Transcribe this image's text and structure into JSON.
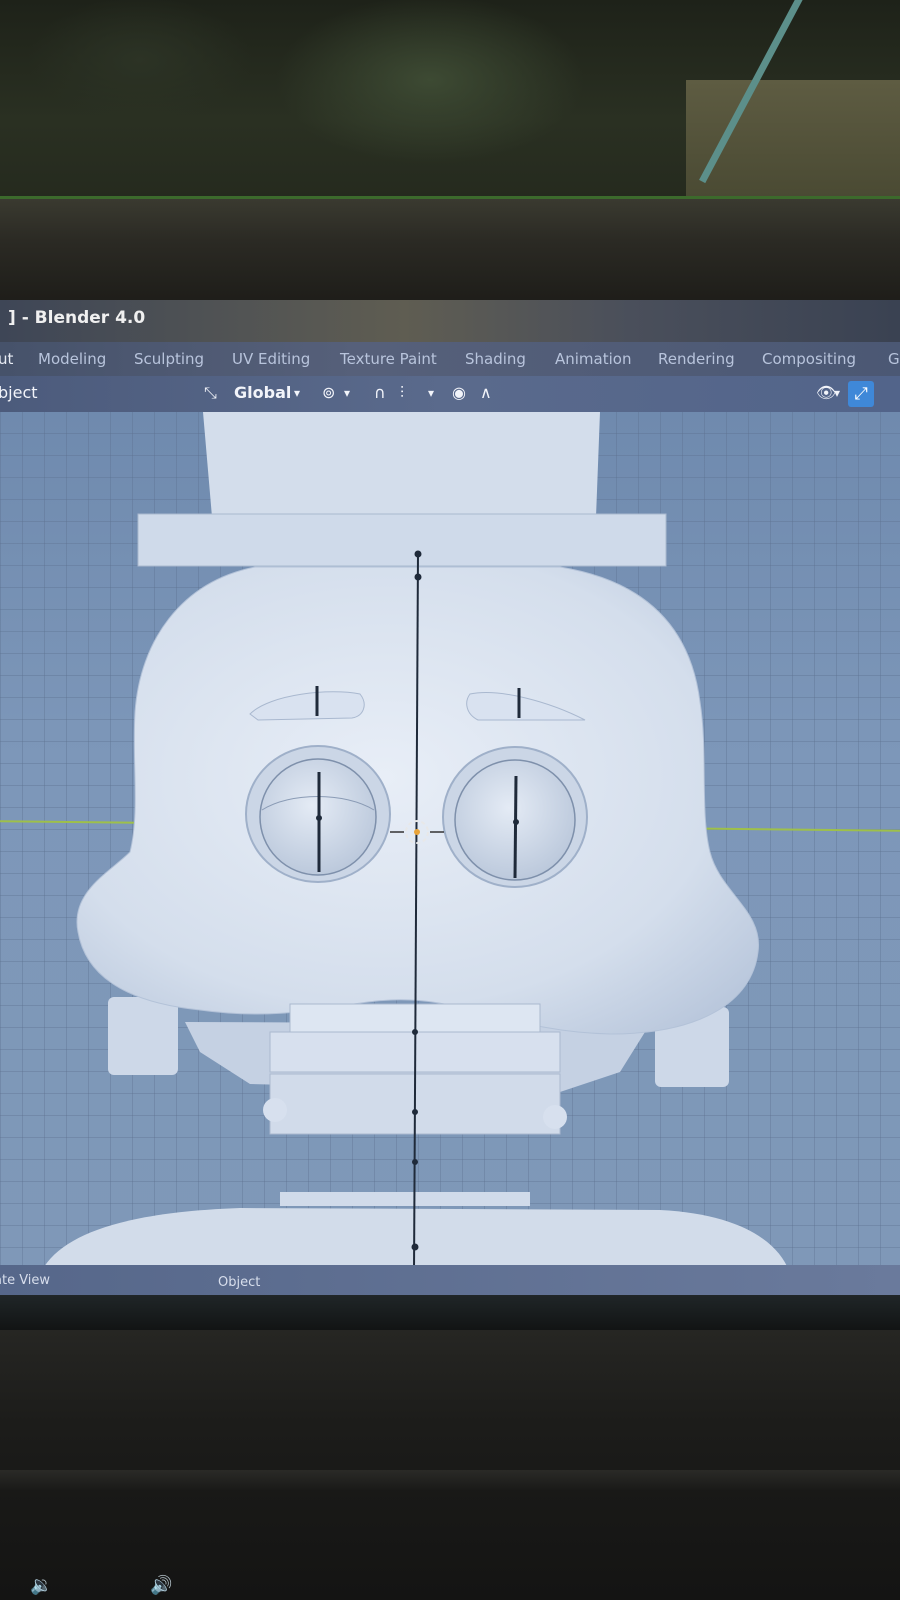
{
  "window": {
    "title": "] - Blender 4.0"
  },
  "workspace_tabs": [
    {
      "label": "ut"
    },
    {
      "label": "Modeling"
    },
    {
      "label": "Sculpting"
    },
    {
      "label": "UV Editing"
    },
    {
      "label": "Texture Paint"
    },
    {
      "label": "Shading"
    },
    {
      "label": "Animation"
    },
    {
      "label": "Rendering"
    },
    {
      "label": "Compositing"
    },
    {
      "label": "G"
    }
  ],
  "toolbar": {
    "mode_label": "bject",
    "transform_icon": "transform-orientation-icon",
    "orientation_label": "Global",
    "pivot_icon": "pivot-point-icon",
    "snap_icon": "snap-magnet-icon",
    "snap_target_icon": "snap-target-icon",
    "proportional_icon": "proportional-edit-icon",
    "falloff_icon": "falloff-curve-icon",
    "visibility_icon": "visibility-eye-icon",
    "gizmo_icon": "gizmo-toggle-icon"
  },
  "statusbar": {
    "left": "ate View",
    "object_label": "Object"
  },
  "colors": {
    "accent": "#3f88d8",
    "x_axis": "#9ec04a",
    "mesh": "#dfe8f4"
  }
}
